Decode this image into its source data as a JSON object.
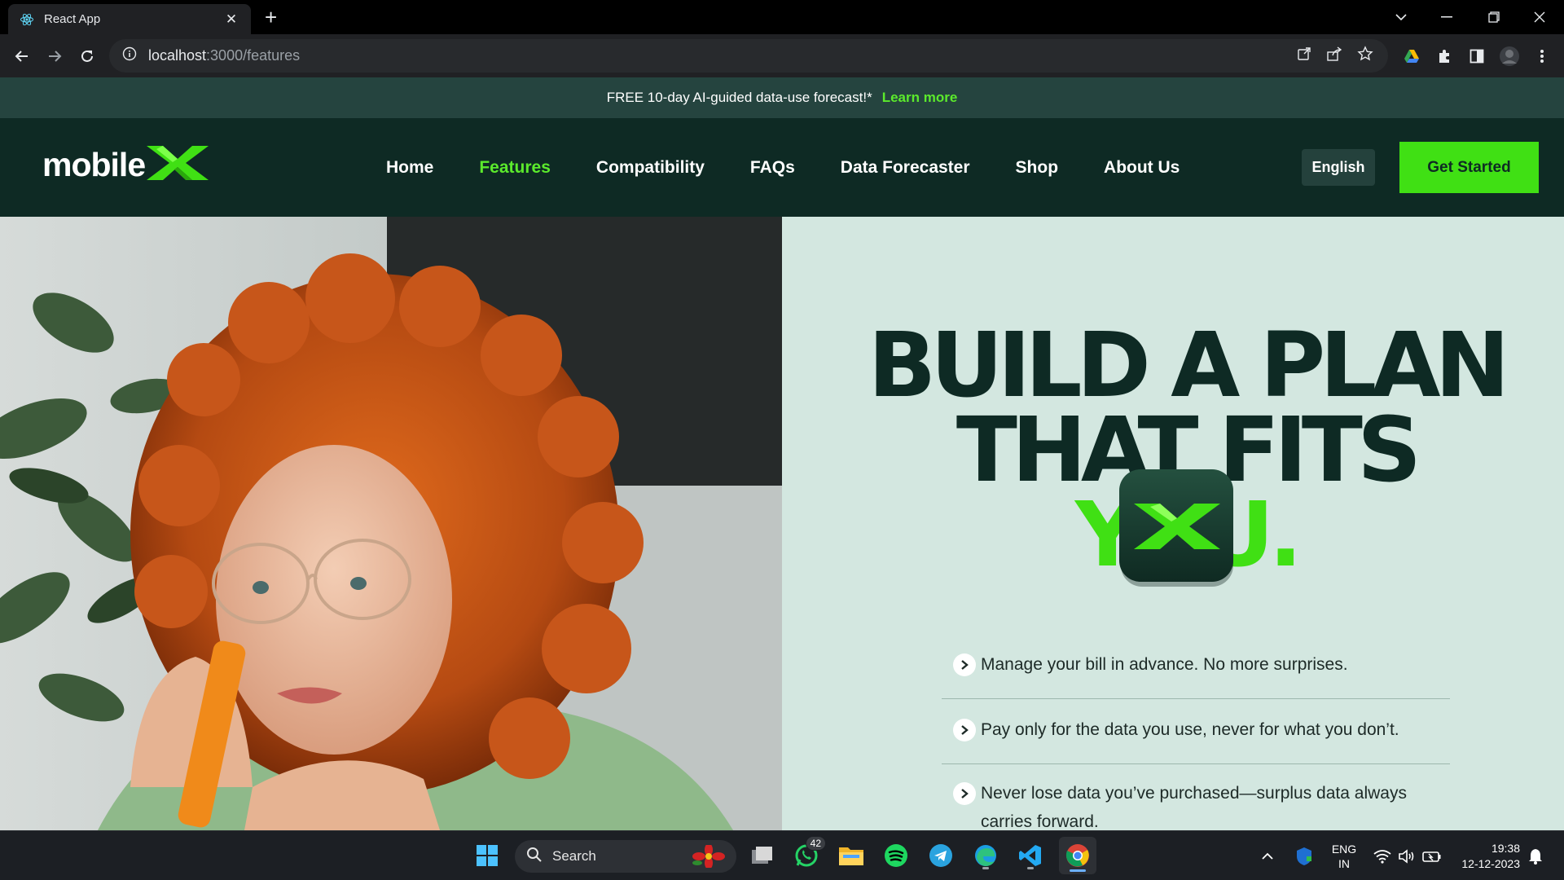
{
  "browser": {
    "tab_title": "React App",
    "url_host": "localhost",
    "url_path": ":3000/features"
  },
  "promo": {
    "text": "FREE 10-day AI-guided data-use forecast!*",
    "link": "Learn more"
  },
  "nav": {
    "logo_text": "mobile",
    "items": [
      {
        "label": "Home"
      },
      {
        "label": "Features"
      },
      {
        "label": "Compatibility"
      },
      {
        "label": "FAQs"
      },
      {
        "label": "Data Forecaster"
      },
      {
        "label": "Shop"
      },
      {
        "label": "About Us"
      }
    ],
    "active_item": "Features",
    "language": "English",
    "cta": "Get Started"
  },
  "hero": {
    "headline_line1": "BUILD A PLAN",
    "headline_line2": "THAT FITS",
    "headline_highlight": "YOU.",
    "features": [
      {
        "text": "Manage your bill in advance. No more surprises."
      },
      {
        "text": "Pay only for the data you use, never for what you don’t."
      },
      {
        "text": "Never lose data you’ve purchased—surplus data always carries forward."
      }
    ]
  },
  "taskbar": {
    "search_label": "Search",
    "whatsapp_badge": "42",
    "lang_line1": "ENG",
    "lang_line2": "IN",
    "time": "19:38",
    "date": "12-12-2023"
  },
  "colors": {
    "brand_dark": "#0e2a24",
    "brand_green": "#40e014",
    "hero_bg": "#d3e7e0",
    "promo_bg": "#25443f"
  }
}
